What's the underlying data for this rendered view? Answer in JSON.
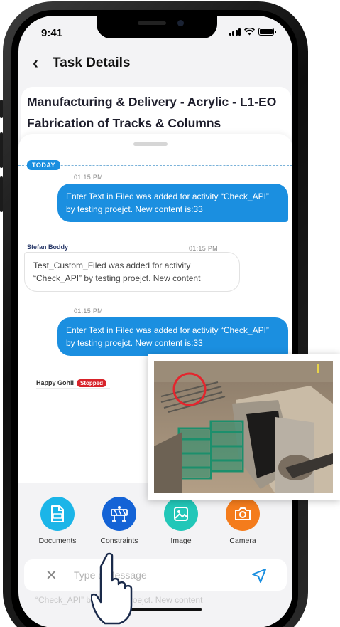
{
  "status_bar": {
    "time": "9:41"
  },
  "header": {
    "title": "Task Details"
  },
  "task": {
    "title": "Manufacturing & Delivery - Acrylic - L1-EO Fabrication of Tracks & Columns"
  },
  "chat": {
    "day_label": "TODAY",
    "messages": [
      {
        "time": "01:15 PM",
        "text": "Enter Text in Filed was added for activity “Check_API” by testing proejct. New content is:33"
      },
      {
        "sender": "Stefan Boddy",
        "time": "01:15 PM",
        "text": "Test_Custom_Filed was added for activity “Check_API” by testing proejct. New content"
      },
      {
        "time": "01:15 PM",
        "text": "Enter Text in Filed was added for activity “Check_API” by testing proejct. New content is:33"
      },
      {
        "sender": "Happy Gohil",
        "badge": "Stopped"
      }
    ]
  },
  "actions": [
    {
      "label": "Documents",
      "icon": "document-icon",
      "color": "#1bb5e8"
    },
    {
      "label": "Constraints",
      "icon": "barrier-icon",
      "color": "#1463d6"
    },
    {
      "label": "Image",
      "icon": "image-icon",
      "color": "#22c7b8"
    },
    {
      "label": "Camera",
      "icon": "camera-icon",
      "color": "#f47c1c"
    }
  ],
  "composer": {
    "placeholder": "Type a Message",
    "behind_text": "“Check_API” by testing proejct. New content"
  },
  "colors": {
    "accent": "#1b8fe0",
    "stopped": "#d8232a"
  }
}
